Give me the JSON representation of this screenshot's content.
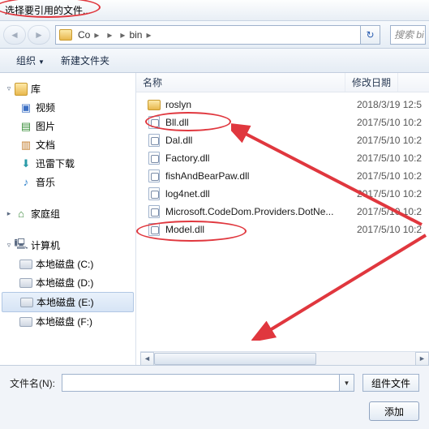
{
  "window": {
    "title": "选择要引用的文件..."
  },
  "breadcrumb": {
    "parts": [
      "Co",
      "",
      "",
      "bin"
    ],
    "refresh_icon": "↻"
  },
  "search": {
    "placeholder": "搜索 bi"
  },
  "toolbar": {
    "organize": "组织",
    "new_folder": "新建文件夹"
  },
  "sidebar": {
    "libraries": {
      "label": "库",
      "items": [
        {
          "label": "视频"
        },
        {
          "label": "图片"
        },
        {
          "label": "文档"
        },
        {
          "label": "迅雷下载"
        },
        {
          "label": "音乐"
        }
      ]
    },
    "homegroup": {
      "label": "家庭组"
    },
    "computer": {
      "label": "计算机",
      "drives": [
        {
          "label": "本地磁盘 (C:)"
        },
        {
          "label": "本地磁盘 (D:)"
        },
        {
          "label": "本地磁盘 (E:)"
        },
        {
          "label": "本地磁盘 (F:)"
        }
      ]
    }
  },
  "columns": {
    "name": "名称",
    "modified": "修改日期"
  },
  "files": [
    {
      "name": "roslyn",
      "type": "folder",
      "date": "2018/3/19 12:5"
    },
    {
      "name": "Bll.dll",
      "type": "dll",
      "date": "2017/5/10 10:2"
    },
    {
      "name": "Dal.dll",
      "type": "dll",
      "date": "2017/5/10 10:2"
    },
    {
      "name": "Factory.dll",
      "type": "dll",
      "date": "2017/5/10 10:2"
    },
    {
      "name": "fishAndBearPaw.dll",
      "type": "dll",
      "date": "2017/5/10 10:2"
    },
    {
      "name": "log4net.dll",
      "type": "dll",
      "date": "2017/5/10 10:2"
    },
    {
      "name": "Microsoft.CodeDom.Providers.DotNe...",
      "type": "dll",
      "date": "2017/5/10 10:2"
    },
    {
      "name": "Model.dll",
      "type": "dll",
      "date": "2017/5/10 10:2"
    }
  ],
  "footer": {
    "filename_label": "文件名(N):",
    "filter_label": "组件文件",
    "add_label": "添加"
  },
  "annotations": {
    "highlighted": [
      "Bll.dll",
      "Model.dll"
    ]
  }
}
